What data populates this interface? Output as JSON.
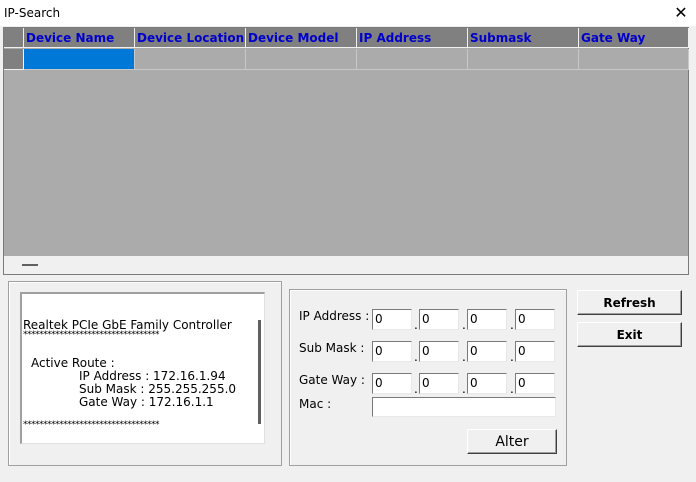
{
  "window": {
    "title": "IP-Search",
    "close_glyph": "✕"
  },
  "grid": {
    "columns": [
      "Device Name",
      "Device Location",
      "Device Model",
      "IP Address",
      "Submask",
      "Gate Way"
    ],
    "selected_row": 0,
    "selected_column": 0
  },
  "info": {
    "adapter": "Realtek PCIe GbE Family Controller",
    "separator": "**********************************",
    "active_route_label": "Active Route :",
    "ip_line": "IP Address : 172.16.1.94",
    "mask_line": "Sub Mask : 255.255.255.0",
    "gateway_line": "Gate Way : 172.16.1.1",
    "separator_bottom": "**********************************"
  },
  "form": {
    "ip_label": "IP Address :",
    "mask_label": "Sub Mask :",
    "gateway_label": "Gate Way :",
    "mac_label": "Mac :",
    "ip": [
      "0",
      "0",
      "0",
      "0"
    ],
    "mask": [
      "0",
      "0",
      "0",
      "0"
    ],
    "gateway": [
      "0",
      "0",
      "0",
      "0"
    ],
    "mac": "",
    "alter_label": "Alter"
  },
  "buttons": {
    "refresh_label": "Refresh",
    "exit_label": "Exit"
  }
}
